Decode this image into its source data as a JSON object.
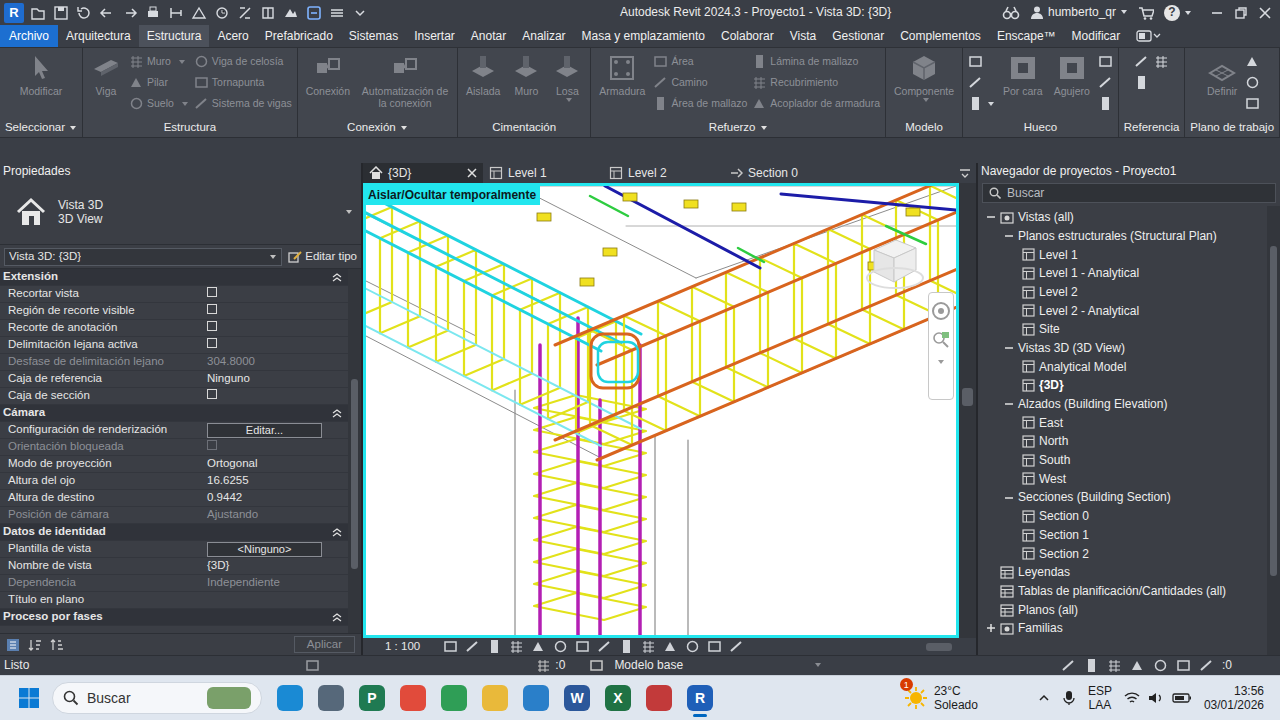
{
  "window": {
    "app_icon": "R",
    "title": "Autodesk Revit 2024.3 - Proyecto1 - Vista 3D: {3D}",
    "user": "humberto_qr",
    "help": "?"
  },
  "ribbon": {
    "file_tab": "Archivo",
    "tabs": [
      {
        "label": "Arquitectura",
        "selected": false
      },
      {
        "label": "Estructura",
        "selected": true
      },
      {
        "label": "Acero",
        "selected": false
      },
      {
        "label": "Prefabricado",
        "selected": false
      },
      {
        "label": "Sistemas",
        "selected": false
      },
      {
        "label": "Insertar",
        "selected": false
      },
      {
        "label": "Anotar",
        "selected": false
      },
      {
        "label": "Analizar",
        "selected": false
      },
      {
        "label": "Masa y emplazamiento",
        "selected": false
      },
      {
        "label": "Colaborar",
        "selected": false
      },
      {
        "label": "Vista",
        "selected": false
      },
      {
        "label": "Gestionar",
        "selected": false
      },
      {
        "label": "Complementos",
        "selected": false
      },
      {
        "label": "Enscape™",
        "selected": false
      },
      {
        "label": "Modificar",
        "selected": false
      }
    ],
    "panels": [
      {
        "title": "Seleccionar",
        "dropdown": true,
        "columns": [
          [
            {
              "label": "Modificar",
              "kind": "large",
              "disabled": true
            }
          ]
        ]
      },
      {
        "title": "Estructura",
        "dropdown": false,
        "columns": [
          [
            {
              "label": "Viga",
              "kind": "large",
              "disabled": true
            }
          ],
          [
            {
              "label": "Muro",
              "kind": "small",
              "disabled": true,
              "dropdown": true
            },
            {
              "label": "Pilar",
              "kind": "small",
              "disabled": true
            },
            {
              "label": "Suelo",
              "kind": "small",
              "disabled": true,
              "dropdown": true
            }
          ],
          [
            {
              "label": "Viga de celosía",
              "kind": "small",
              "disabled": true
            },
            {
              "label": "Tornapunta",
              "kind": "small",
              "disabled": true
            },
            {
              "label": "Sistema de vigas",
              "kind": "small",
              "disabled": true
            }
          ]
        ]
      },
      {
        "title": "Conexión",
        "dropdown": true,
        "columns": [
          [
            {
              "label": "Conexión",
              "kind": "large",
              "disabled": true
            }
          ],
          [
            {
              "label": "Automatización de la conexión",
              "kind": "large",
              "disabled": true
            }
          ]
        ]
      },
      {
        "title": "Cimentación",
        "dropdown": false,
        "columns": [
          [
            {
              "label": "Aislada",
              "kind": "large",
              "disabled": true
            }
          ],
          [
            {
              "label": "Muro",
              "kind": "large",
              "disabled": true
            }
          ],
          [
            {
              "label": "Losa",
              "kind": "large",
              "disabled": true,
              "dropdown": true
            }
          ]
        ]
      },
      {
        "title": "Refuerzo",
        "dropdown": true,
        "columns": [
          [
            {
              "label": "Armadura",
              "kind": "large",
              "disabled": true
            }
          ],
          [
            {
              "label": "Área",
              "kind": "small",
              "disabled": true
            },
            {
              "label": "Camino",
              "kind": "small",
              "disabled": true
            },
            {
              "label": "Área de mallazo",
              "kind": "small",
              "disabled": true
            }
          ],
          [
            {
              "label": "Lámina de mallazo",
              "kind": "small",
              "disabled": true
            },
            {
              "label": "Recubrimiento",
              "kind": "small",
              "disabled": true
            },
            {
              "label": "Acoplador de armadura",
              "kind": "small",
              "disabled": true
            }
          ]
        ]
      },
      {
        "title": "Modelo",
        "dropdown": false,
        "columns": [
          [
            {
              "label": "Componente",
              "kind": "large",
              "disabled": true,
              "dropdown": true
            }
          ]
        ]
      },
      {
        "title": "Hueco",
        "dropdown": false,
        "columns": [
          [
            {
              "kind": "icon",
              "disabled": false
            },
            {
              "kind": "icon",
              "disabled": false
            },
            {
              "kind": "icon",
              "disabled": false,
              "dropdown": true
            }
          ],
          [
            {
              "label": "Por cara",
              "kind": "large",
              "disabled": true
            }
          ],
          [
            {
              "label": "Agujero",
              "kind": "large",
              "disabled": true
            }
          ],
          [
            {
              "kind": "icon",
              "disabled": false
            },
            {
              "kind": "icon",
              "disabled": false
            },
            {
              "kind": "icon",
              "disabled": false
            }
          ]
        ]
      },
      {
        "title": "Referencia",
        "dropdown": false,
        "columns": [
          [
            {
              "kind": "icon",
              "disabled": false
            },
            {
              "kind": "icon",
              "disabled": false
            }
          ],
          [
            {
              "kind": "icon",
              "disabled": false
            }
          ]
        ]
      },
      {
        "title": "Plano de trabajo",
        "dropdown": false,
        "columns": [
          [
            {
              "label": "Definir",
              "kind": "large",
              "disabled": true
            }
          ],
          [
            {
              "kind": "icon",
              "disabled": false
            },
            {
              "kind": "icon",
              "disabled": false
            },
            {
              "kind": "icon",
              "disabled": false
            }
          ]
        ]
      }
    ]
  },
  "properties": {
    "title": "Propiedades",
    "type_name": "Vista 3D",
    "type_family": "3D View",
    "instance": "Vista 3D: {3D}",
    "edit_type": "Editar tipo",
    "sections": [
      {
        "title": "Extensión",
        "expanded": true,
        "rows": [
          {
            "label": "Recortar vista",
            "kind": "check",
            "checked": false,
            "disabled": false
          },
          {
            "label": "Región de recorte visible",
            "kind": "check",
            "checked": false,
            "disabled": false
          },
          {
            "label": "Recorte de anotación",
            "kind": "check",
            "checked": false,
            "disabled": false
          },
          {
            "label": "Delimitación lejana activa",
            "kind": "check",
            "checked": false,
            "disabled": false
          },
          {
            "label": "Desfase de delimitación lejano",
            "kind": "text",
            "value": "304.8000",
            "disabled": true
          },
          {
            "label": "Caja de referencia",
            "kind": "text",
            "value": "Ninguno",
            "disabled": false
          },
          {
            "label": "Caja de sección",
            "kind": "check",
            "checked": false,
            "disabled": false
          }
        ]
      },
      {
        "title": "Cámara",
        "expanded": true,
        "rows": [
          {
            "label": "Configuración de renderización",
            "kind": "button",
            "value": "Editar...",
            "disabled": false
          },
          {
            "label": "Orientación bloqueada",
            "kind": "check",
            "checked": false,
            "disabled": true
          },
          {
            "label": "Modo de proyección",
            "kind": "text",
            "value": "Ortogonal",
            "disabled": false
          },
          {
            "label": "Altura del ojo",
            "kind": "text",
            "value": "16.6255",
            "disabled": false
          },
          {
            "label": "Altura de destino",
            "kind": "text",
            "value": "0.9442",
            "disabled": false
          },
          {
            "label": "Posición de cámara",
            "kind": "text",
            "value": "Ajustando",
            "disabled": true
          }
        ]
      },
      {
        "title": "Datos de identidad",
        "expanded": true,
        "rows": [
          {
            "label": "Plantilla de vista",
            "kind": "button",
            "value": "<Ninguno>",
            "disabled": false
          },
          {
            "label": "Nombre de vista",
            "kind": "text",
            "value": "{3D}",
            "disabled": false
          },
          {
            "label": "Dependencia",
            "kind": "text",
            "value": "Independiente",
            "disabled": true
          },
          {
            "label": "Título en plano",
            "kind": "empty",
            "disabled": false
          }
        ]
      },
      {
        "title": "Proceso por fases",
        "expanded": true,
        "rows": []
      }
    ],
    "apply": "Aplicar",
    "apply_disabled": true
  },
  "view_tabs": [
    {
      "label": "{3D}",
      "kind": "3d",
      "selected": true
    },
    {
      "label": "Level 1",
      "kind": "plan",
      "selected": false
    },
    {
      "label": "Level 2",
      "kind": "plan",
      "selected": false
    },
    {
      "label": "Section 0",
      "kind": "section",
      "selected": false
    }
  ],
  "view": {
    "banner": "Aislar/Ocultar temporalmente",
    "scale": "1 : 100"
  },
  "browser": {
    "title": "Navegador de proyectos - Proyecto1",
    "search_placeholder": "Buscar",
    "items": [
      {
        "label": "Vistas (all)",
        "level": 0,
        "kind": "root",
        "expanded": true,
        "selected": false
      },
      {
        "label": "Planos estructurales (Structural Plan)",
        "level": 1,
        "kind": "group",
        "expanded": true,
        "selected": false
      },
      {
        "label": "Level 1",
        "level": 2,
        "kind": "view",
        "selected": false
      },
      {
        "label": "Level 1 - Analytical",
        "level": 2,
        "kind": "view",
        "selected": false
      },
      {
        "label": "Level 2",
        "level": 2,
        "kind": "view",
        "selected": false
      },
      {
        "label": "Level 2 - Analytical",
        "level": 2,
        "kind": "view",
        "selected": false
      },
      {
        "label": "Site",
        "level": 2,
        "kind": "view",
        "selected": false
      },
      {
        "label": "Vistas 3D (3D View)",
        "level": 1,
        "kind": "group",
        "expanded": true,
        "selected": false
      },
      {
        "label": "Analytical Model",
        "level": 2,
        "kind": "view",
        "selected": false
      },
      {
        "label": "{3D}",
        "level": 2,
        "kind": "view",
        "selected": true
      },
      {
        "label": "Alzados (Building Elevation)",
        "level": 1,
        "kind": "group",
        "expanded": true,
        "selected": false
      },
      {
        "label": "East",
        "level": 2,
        "kind": "view",
        "selected": false
      },
      {
        "label": "North",
        "level": 2,
        "kind": "view",
        "selected": false
      },
      {
        "label": "South",
        "level": 2,
        "kind": "view",
        "selected": false
      },
      {
        "label": "West",
        "level": 2,
        "kind": "view",
        "selected": false
      },
      {
        "label": "Secciones (Building Section)",
        "level": 1,
        "kind": "group",
        "expanded": true,
        "selected": false
      },
      {
        "label": "Section 0",
        "level": 2,
        "kind": "view",
        "selected": false
      },
      {
        "label": "Section 1",
        "level": 2,
        "kind": "view",
        "selected": false
      },
      {
        "label": "Section 2",
        "level": 2,
        "kind": "view",
        "selected": false
      },
      {
        "label": "Leyendas",
        "level": 0,
        "kind": "category",
        "selected": false
      },
      {
        "label": "Tablas de planificación/Cantidades (all)",
        "level": 0,
        "kind": "category",
        "selected": false
      },
      {
        "label": "Planos (all)",
        "level": 0,
        "kind": "category",
        "selected": false
      },
      {
        "label": "Familias",
        "level": 0,
        "kind": "root",
        "expanded": false,
        "selected": false
      }
    ]
  },
  "status_bar": {
    "message": "Listo",
    "selection_count": ":0",
    "model": "Modelo base",
    "filter_count": ":0"
  },
  "taskbar": {
    "search_placeholder": "Buscar",
    "apps": [
      {
        "color": "#1a8ad4",
        "selected": false
      },
      {
        "color": "#56687a",
        "selected": false
      },
      {
        "glyph": "P",
        "color": "#1f7a52",
        "selected": false
      },
      {
        "color": "#e14b3b",
        "selected": false
      },
      {
        "color": "#2f9e56",
        "selected": false
      },
      {
        "color": "#e9b93a",
        "selected": false
      },
      {
        "color": "#2a7fc9",
        "selected": false
      },
      {
        "glyph": "W",
        "color": "#2b579a",
        "selected": false
      },
      {
        "glyph": "X",
        "color": "#1f7244",
        "selected": false
      },
      {
        "color": "#c23a3a",
        "selected": false
      },
      {
        "glyph": "R",
        "color": "#1f5fb8",
        "selected": true
      }
    ],
    "weather": {
      "badge": "1",
      "temp": "23°C",
      "desc": "Soleado"
    },
    "language": "ESP",
    "layout": "LAA",
    "time": "13:56",
    "date": "03/01/2026"
  }
}
